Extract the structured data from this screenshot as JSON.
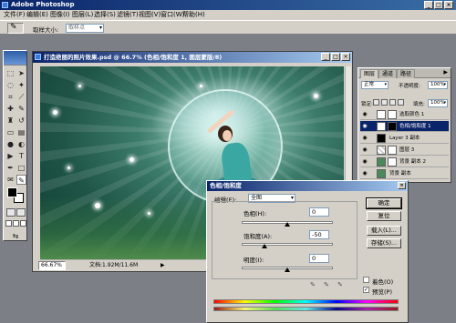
{
  "app": {
    "title": "Adobe Photoshop"
  },
  "menu": [
    "文件(F)",
    "编辑(E)",
    "图像(I)",
    "图层(L)",
    "选择(S)",
    "滤镜(T)",
    "视图(V)",
    "窗口(W)",
    "帮助(H)"
  ],
  "options": {
    "sample_size_label": "取样大小:",
    "sample_size_value": "取样点"
  },
  "document": {
    "title": "打造绝丽的照片效果.psd @ 66.7% (色相/饱和度 1, 图层蒙版/8)",
    "zoom": "66.67%",
    "doc_size": "文档:1.92M/11.6M"
  },
  "layers_panel": {
    "tabs": [
      "图层",
      "通道",
      "路径"
    ],
    "blend_mode": "正常",
    "opacity_label": "不透明度:",
    "opacity_value": "100%",
    "lock_label": "锁定:",
    "fill_label": "填充:",
    "fill_value": "100%",
    "layers": [
      {
        "name": "选取颜色 1",
        "selected": false
      },
      {
        "name": "色相/饱和度 1",
        "selected": true
      },
      {
        "name": "Layer 3 副本",
        "selected": false
      },
      {
        "name": "图层 3",
        "selected": false
      },
      {
        "name": "背景 副本 2",
        "selected": false
      },
      {
        "name": "背景 副本",
        "selected": false
      }
    ]
  },
  "dialog": {
    "title": "色相/饱和度",
    "edit_label": "编辑(E):",
    "edit_value": "全图",
    "hue_label": "色相(H):",
    "hue_value": "0",
    "saturation_label": "饱和度(A):",
    "saturation_value": "-50",
    "lightness_label": "明度(I):",
    "lightness_value": "0",
    "ok": "确定",
    "reset": "复位",
    "load": "载入(L)...",
    "save": "存储(S)...",
    "colorize": "着色(O)",
    "preview": "预览(P)",
    "preview_checked": true,
    "colorize_checked": false,
    "slider_levels": {
      "hue": 0,
      "saturation": -50,
      "lightness": 0
    }
  }
}
